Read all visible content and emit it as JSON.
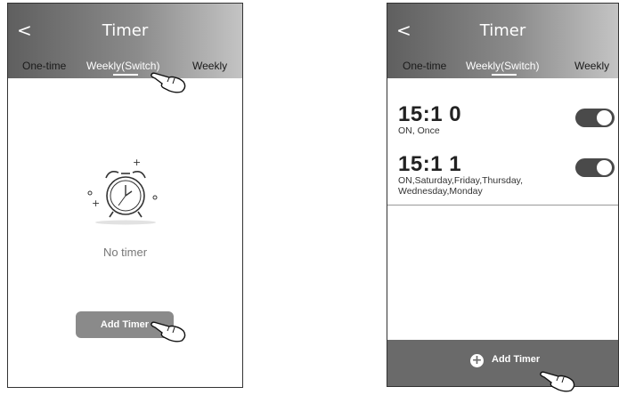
{
  "left": {
    "header": {
      "back": "<",
      "title": "Timer"
    },
    "tabs": [
      "One-time",
      "Weekly(Switch)",
      "Weekly"
    ],
    "empty_text": "No timer",
    "add_button": "Add Timer"
  },
  "right": {
    "header": {
      "back": "<",
      "title": "Timer"
    },
    "tabs": [
      "One-time",
      "Weekly(Switch)",
      "Weekly"
    ],
    "timers": [
      {
        "time": "15:1 0",
        "desc": "ON, Once",
        "enabled": true
      },
      {
        "time": "15:1 1",
        "desc": "ON,Saturday,Friday,Thursday, Wednesday,Monday",
        "enabled": true
      }
    ],
    "add_button": "Add Timer"
  },
  "colors": {
    "header_dark": "#5f5f5f",
    "toggle": "#4a4a4a",
    "bottom_bar": "#6a6a6a"
  },
  "icons": [
    "back-chevron-icon",
    "alarm-clock-icon",
    "pointing-hand-icon",
    "plus-circle-icon",
    "toggle-switch"
  ]
}
